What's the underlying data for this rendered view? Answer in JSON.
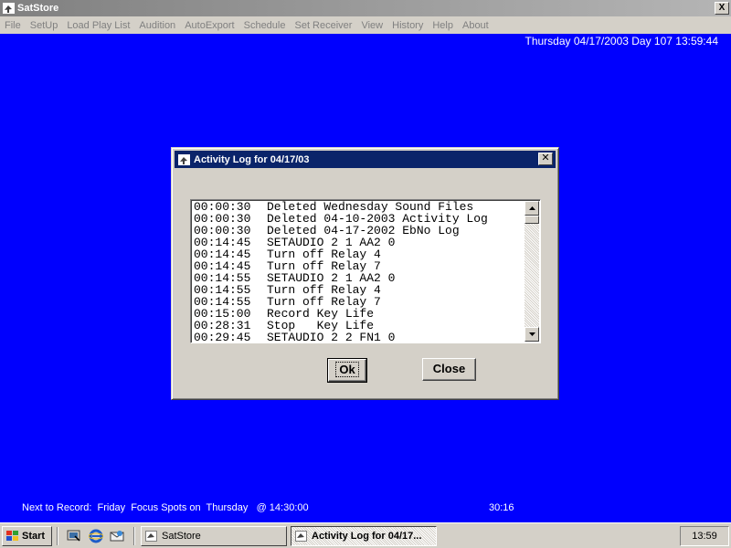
{
  "window": {
    "title": "SatStore",
    "close_glyph": "X"
  },
  "menu": [
    {
      "label": "File"
    },
    {
      "label": "SetUp"
    },
    {
      "label": "Load Play List"
    },
    {
      "label": "Audition"
    },
    {
      "label": "AutoExport"
    },
    {
      "label": "Schedule"
    },
    {
      "label": "Set Receiver"
    },
    {
      "label": "View"
    },
    {
      "label": "History"
    },
    {
      "label": "Help"
    },
    {
      "label": "About"
    }
  ],
  "datetime": "Thursday  04/17/2003  Day  107  13:59:44",
  "dialog": {
    "title": "Activity Log for 04/17/03",
    "close_glyph": "✕",
    "log": [
      {
        "time": "00:00:30",
        "text": "Deleted Wednesday Sound Files"
      },
      {
        "time": "00:00:30",
        "text": "Deleted 04-10-2003 Activity Log"
      },
      {
        "time": "00:00:30",
        "text": "Deleted 04-17-2002 EbNo Log"
      },
      {
        "time": "00:14:45",
        "text": "SETAUDIO 2 1 AA2 0"
      },
      {
        "time": "00:14:45",
        "text": "Turn off Relay 4"
      },
      {
        "time": "00:14:45",
        "text": "Turn off Relay 7"
      },
      {
        "time": "00:14:55",
        "text": "SETAUDIO 2 1 AA2 0"
      },
      {
        "time": "00:14:55",
        "text": "Turn off Relay 4"
      },
      {
        "time": "00:14:55",
        "text": "Turn off Relay 7"
      },
      {
        "time": "00:15:00",
        "text": "Record Key Life"
      },
      {
        "time": "00:28:31",
        "text": "Stop   Key Life"
      },
      {
        "time": "00:29:45",
        "text": "SETAUDIO 2 2 FN1 0"
      }
    ],
    "ok_label": "Ok",
    "close_label": "Close"
  },
  "status": {
    "next_to_record": "Next to Record:  Friday  Focus Spots on  Thursday   @ 14:30:00",
    "timer": "30:16"
  },
  "taskbar": {
    "start_label": "Start",
    "tasks": [
      {
        "label": "SatStore"
      },
      {
        "label": "Activity Log for 04/17..."
      }
    ],
    "clock": "13:59"
  },
  "colors": {
    "desktop": "#0000FE",
    "dialog_title": "#0A246A",
    "chrome": "#D4D0C8"
  }
}
